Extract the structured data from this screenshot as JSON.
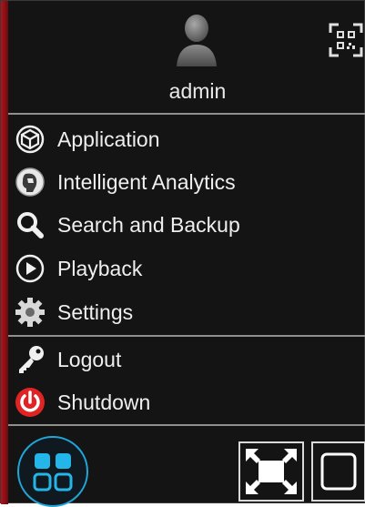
{
  "user": {
    "name": "admin"
  },
  "menu": {
    "items": [
      {
        "label": "Application",
        "icon": "cube-icon"
      },
      {
        "label": "Intelligent Analytics",
        "icon": "face-analytics-icon"
      },
      {
        "label": "Search and Backup",
        "icon": "search-icon"
      },
      {
        "label": "Playback",
        "icon": "play-circle-icon"
      },
      {
        "label": "Settings",
        "icon": "gear-icon"
      },
      {
        "label": "Logout",
        "icon": "key-icon"
      },
      {
        "label": "Shutdown",
        "icon": "power-icon"
      }
    ]
  },
  "colors": {
    "background": "#141414",
    "text": "#efefef",
    "accent_blue": "#1fa7d8",
    "accent_red": "#e02424",
    "divider": "#8f8f8f"
  }
}
